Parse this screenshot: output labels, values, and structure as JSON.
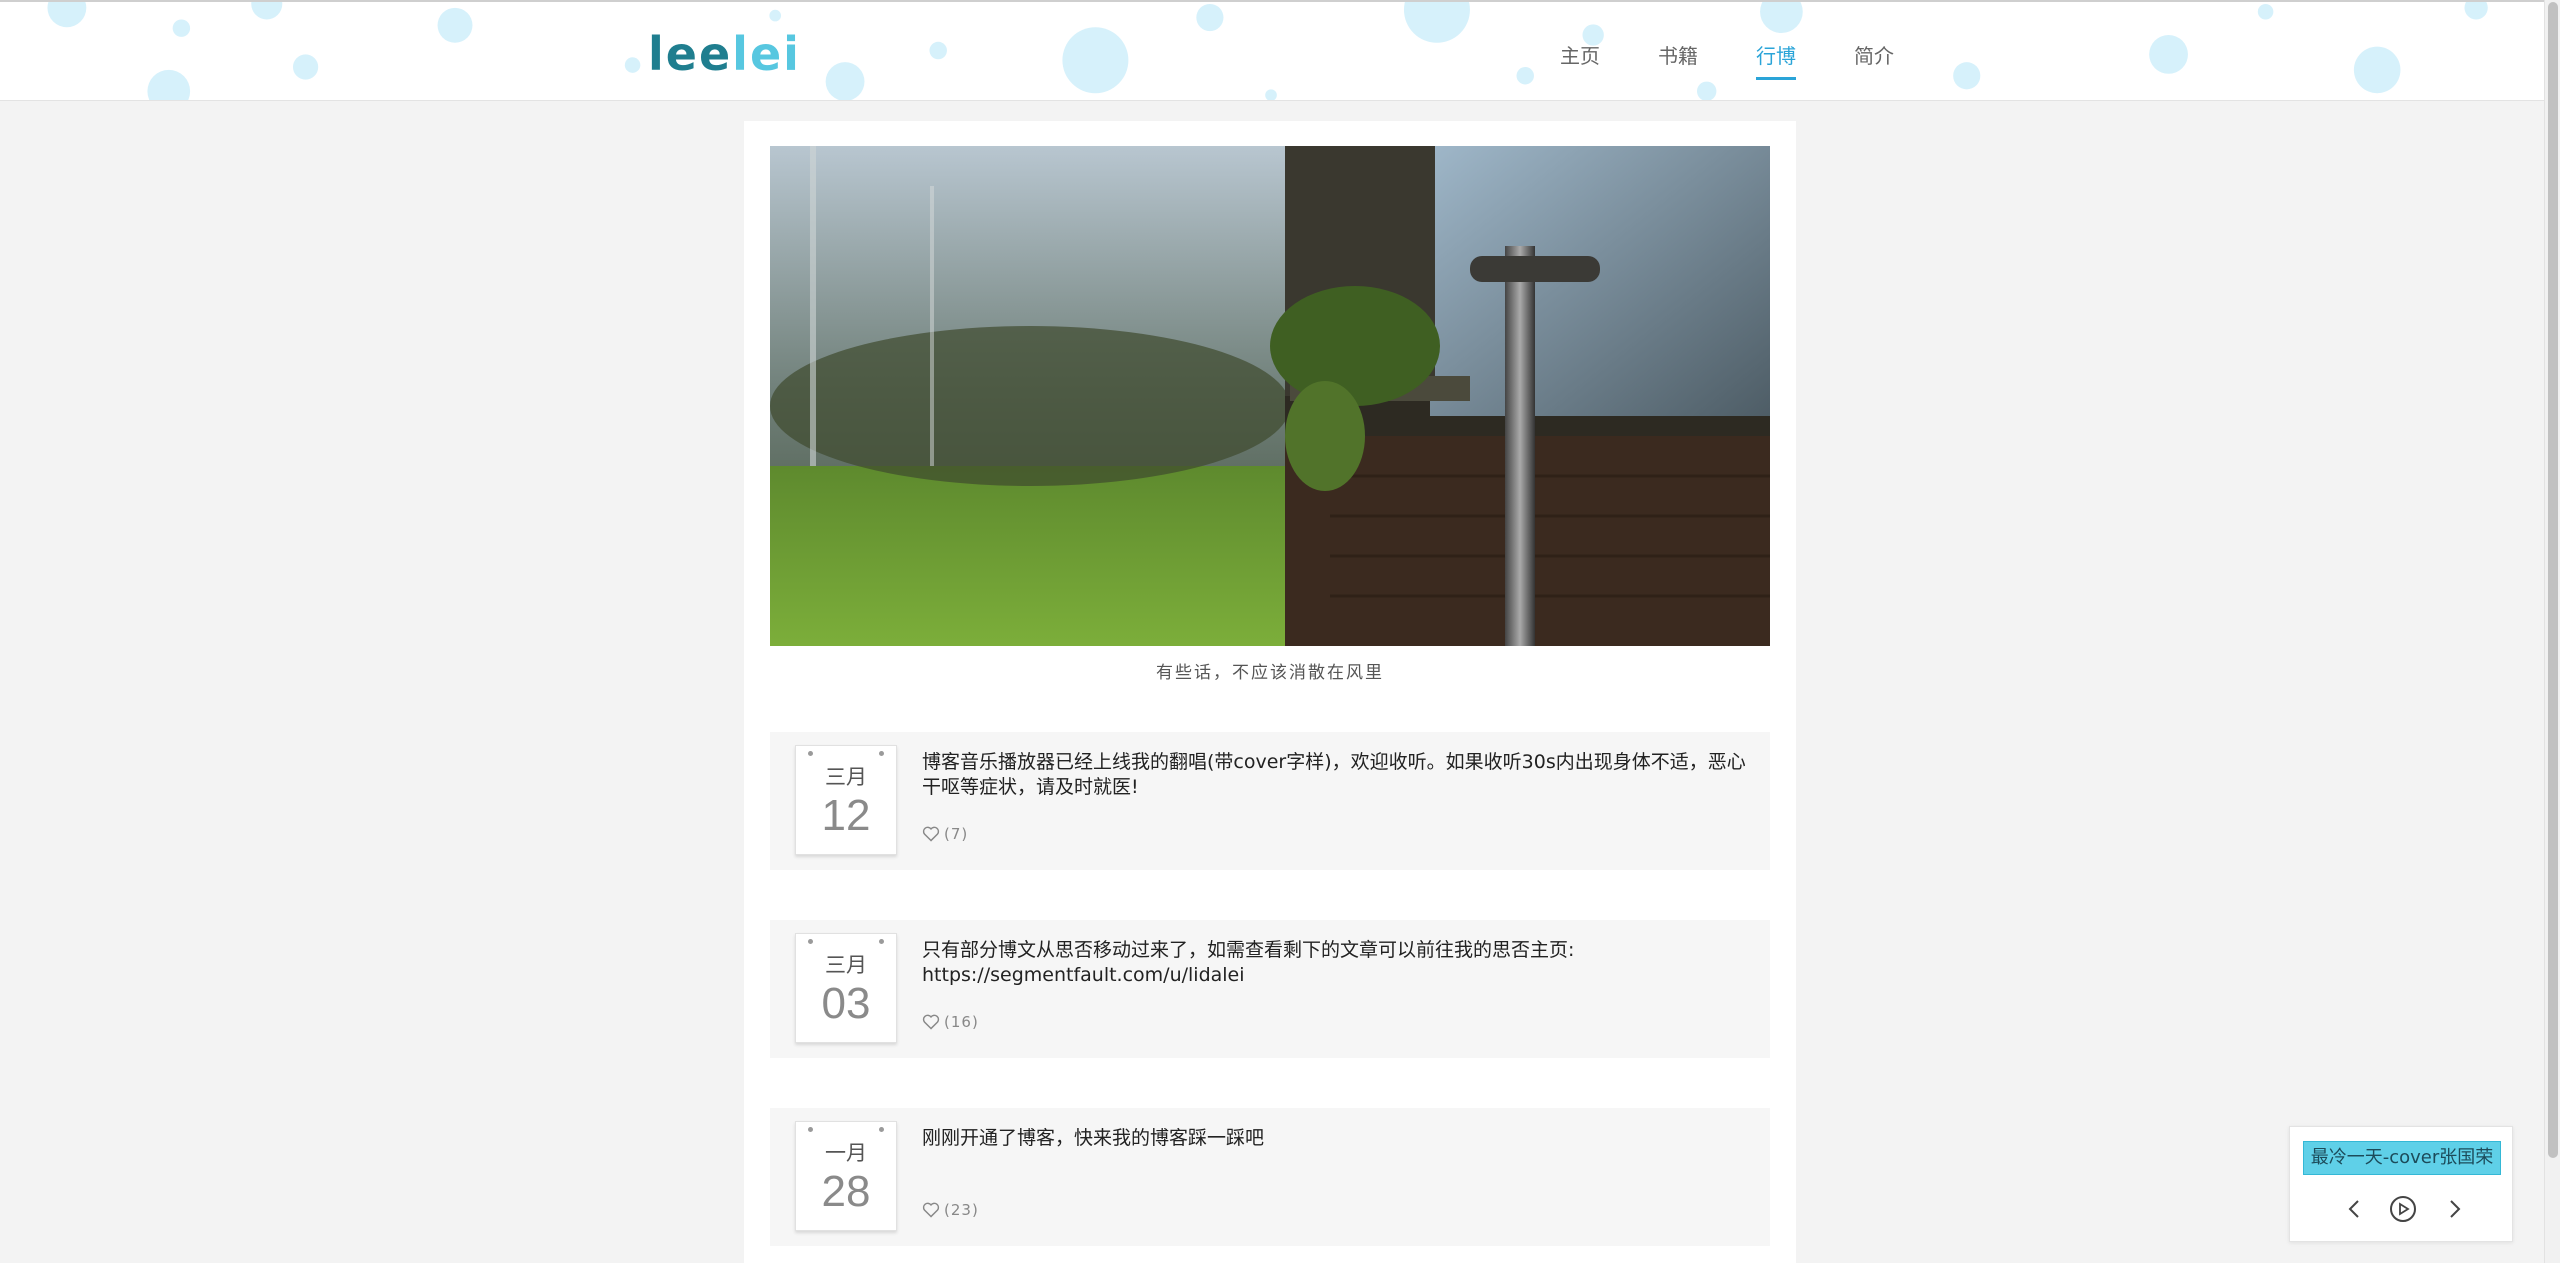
{
  "header": {
    "logo_text_1": "lee",
    "logo_text_2": "lei",
    "nav": [
      {
        "label": "主页",
        "active": false
      },
      {
        "label": "书籍",
        "active": false
      },
      {
        "label": "行博",
        "active": true
      },
      {
        "label": "简介",
        "active": false
      }
    ]
  },
  "hero": {
    "caption": "有些话，不应该消散在风里"
  },
  "posts": [
    {
      "month": "三月",
      "day": "12",
      "text": "博客音乐播放器已经上线我的翻唱(带cover字样)，欢迎收听。如果收听30s内出现身体不适，恶心干呕等症状，请及时就医!",
      "likes": "(7)"
    },
    {
      "month": "三月",
      "day": "03",
      "text": "只有部分博文从思否移动过来了，如需查看剩下的文章可以前往我的思否主页: https://segmentfault.com/u/lidalei",
      "likes": "(16)"
    },
    {
      "month": "一月",
      "day": "28",
      "text": "刚刚开通了博客，快来我的博客踩一踩吧",
      "likes": "(23)"
    }
  ],
  "player": {
    "song": "最冷一天-cover张国荣",
    "icons": [
      "prev-icon",
      "play-icon",
      "next-icon"
    ]
  },
  "colors": {
    "accent": "#2aa4d8",
    "bubble": "#d6f1fb",
    "song_bg": "#5fd0e8"
  }
}
